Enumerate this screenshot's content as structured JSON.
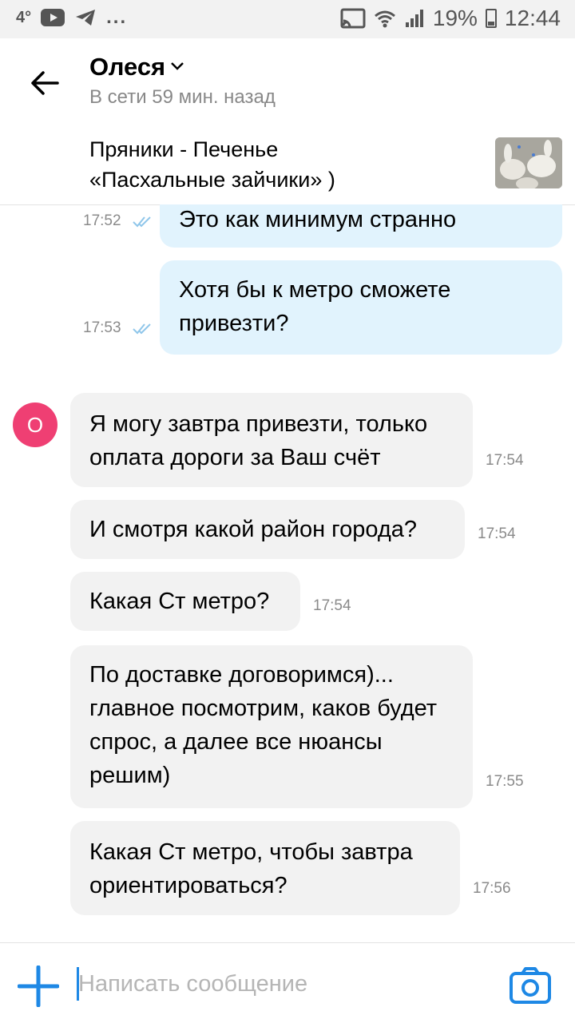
{
  "status_bar": {
    "temperature": "4°",
    "battery": "19%",
    "time": "12:44",
    "icons": [
      "youtube-icon",
      "telegram-icon",
      "cast-icon",
      "wifi-icon",
      "signal-icon",
      "battery-icon"
    ],
    "more": "..."
  },
  "header": {
    "name": "Олеся",
    "status": "В сети 59 мин. назад"
  },
  "product": {
    "title": "Пряники - Печенье\n«Пасхальные зайчики» )"
  },
  "messages": [
    {
      "dir": "out",
      "text": "Это как минимум странно",
      "time": "17:52"
    },
    {
      "dir": "out",
      "text": "Хотя бы к метро сможете привезти?",
      "time": "17:53"
    },
    {
      "dir": "in",
      "text": "Я могу завтра привезти, только оплата дороги за Ваш счёт",
      "time": "17:54"
    },
    {
      "dir": "in",
      "text": "И смотря какой район города?",
      "time": "17:54"
    },
    {
      "dir": "in",
      "text": "Какая Ст метро?",
      "time": "17:54"
    },
    {
      "dir": "in",
      "text": "По доставке договоримся)... главное посмотрим, каков будет спрос, а далее все нюансы решим)",
      "time": "17:55"
    },
    {
      "dir": "in",
      "text": "Какая Ст метро, чтобы завтра ориентироваться?",
      "time": "17:56"
    }
  ],
  "avatar": {
    "letter": "О"
  },
  "composer": {
    "placeholder": "Написать сообщение"
  },
  "colors": {
    "accent": "#1e88e5",
    "outgoing_bubble": "#e1f3fd",
    "incoming_bubble": "#f2f2f2",
    "avatar": "#ef3f73"
  }
}
